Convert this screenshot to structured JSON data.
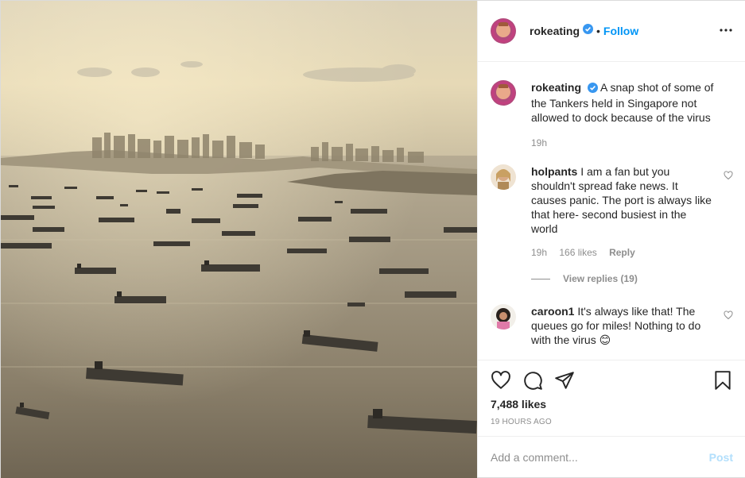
{
  "post": {
    "username": "rokeating",
    "follow_label": "Follow",
    "separator": "•",
    "caption": "A snap shot of some of the Tankers held in Singapore not allowed to dock because of the virus",
    "caption_time": "19h",
    "likes": "7,488 likes",
    "time_ago": "19 HOURS AGO"
  },
  "comments": [
    {
      "username": "holpants",
      "text": "I am a fan but you shouldn't spread fake news. It causes panic. The port is always like that here- second busiest in the world",
      "time": "19h",
      "likes": "166 likes",
      "reply_label": "Reply",
      "view_replies": "View replies (19)"
    },
    {
      "username": "caroon1",
      "text": "It's always like that! The queues go for miles! Nothing to do with the virus 😊"
    }
  ],
  "add_comment": {
    "placeholder": "Add a comment...",
    "post_label": "Post"
  },
  "icons": {
    "verified": "verified-badge-icon",
    "more": "more-options-icon",
    "like": "heart-icon",
    "comment": "comment-icon",
    "share": "share-icon",
    "save": "bookmark-icon"
  },
  "colors": {
    "accent": "#0095f6",
    "post_disabled": "#b2dffc",
    "muted": "#8e8e8e",
    "text": "#262626"
  }
}
